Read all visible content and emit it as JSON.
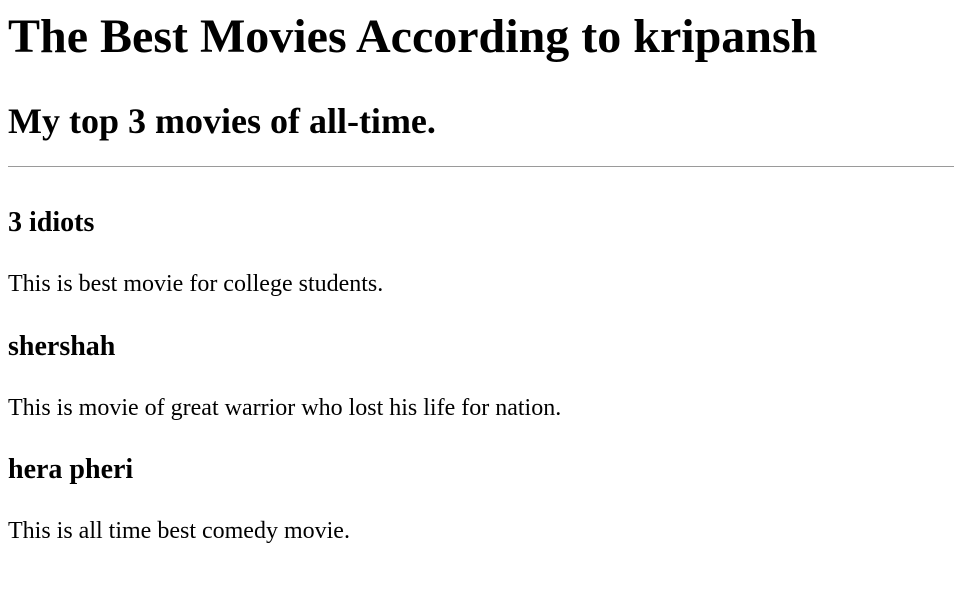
{
  "page": {
    "title": "The Best Movies According to kripansh",
    "subtitle": "My top 3 movies of all-time."
  },
  "movies": [
    {
      "title": "3 idiots",
      "description": "This is best movie for college students."
    },
    {
      "title": "shershah",
      "description": "This is movie of great warrior who lost his life for nation."
    },
    {
      "title": "hera pheri",
      "description": "This is all time best comedy movie."
    }
  ]
}
